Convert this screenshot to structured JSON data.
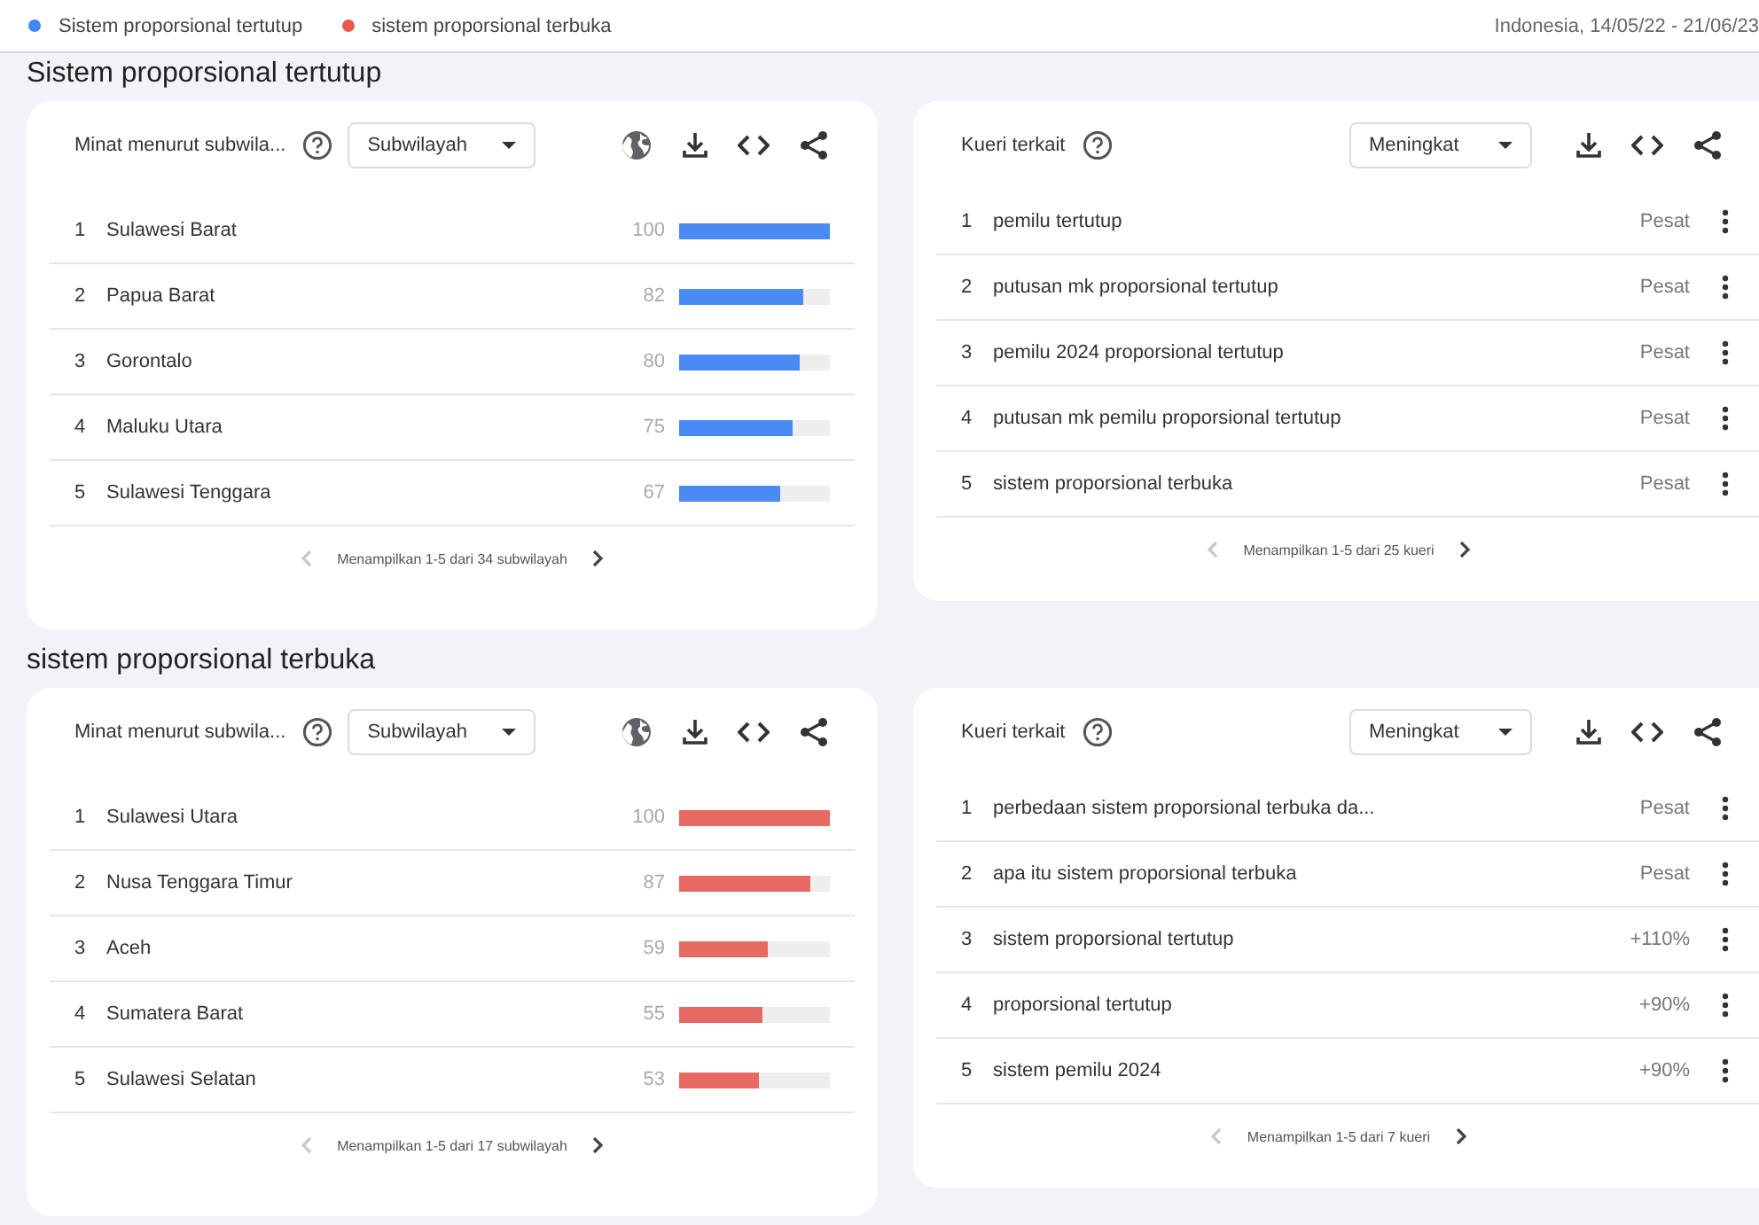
{
  "legend": [
    {
      "label": "Sistem proporsional tertutup",
      "color": "#4285f4"
    },
    {
      "label": "sistem proporsional terbuka",
      "color": "#e8574b"
    }
  ],
  "filter_summary": "Indonesia, 14/05/22 - 21/06/23",
  "sections": [
    {
      "title": "Sistem proporsional tertutup",
      "color": "#4a8af4",
      "cards": [
        {
          "kind": "regions",
          "title": "Minat menurut subwila...",
          "dropdown": "Subwilayah",
          "rows": [
            {
              "rank": "1",
              "name": "Sulawesi Barat",
              "value": "100",
              "level": 1
            },
            {
              "rank": "2",
              "name": "Papua Barat",
              "value": "82",
              "level": 0.82
            },
            {
              "rank": "3",
              "name": "Gorontalo",
              "value": "80",
              "level": 0.8
            },
            {
              "rank": "4",
              "name": "Maluku Utara",
              "value": "75",
              "level": 0.75
            },
            {
              "rank": "5",
              "name": "Sulawesi Tenggara",
              "value": "67",
              "level": 0.67
            }
          ],
          "footer": "Menampilkan 1-5 dari 34 subwilayah"
        },
        {
          "kind": "queries",
          "title": "Kueri terkait",
          "dropdown": "Meningkat",
          "rows": [
            {
              "rank": "1",
              "name": "pemilu tertutup",
              "value": "Pesat"
            },
            {
              "rank": "2",
              "name": "putusan mk proporsional tertutup",
              "value": "Pesat"
            },
            {
              "rank": "3",
              "name": "pemilu 2024 proporsional tertutup",
              "value": "Pesat"
            },
            {
              "rank": "4",
              "name": "putusan mk pemilu proporsional tertutup",
              "value": "Pesat"
            },
            {
              "rank": "5",
              "name": "sistem proporsional terbuka",
              "value": "Pesat"
            }
          ],
          "footer": "Menampilkan 1-5 dari 25 kueri"
        }
      ]
    },
    {
      "title": "sistem proporsional terbuka",
      "color": "#e66a62",
      "cards": [
        {
          "kind": "regions",
          "title": "Minat menurut subwila...",
          "dropdown": "Subwilayah",
          "rows": [
            {
              "rank": "1",
              "name": "Sulawesi Utara",
              "value": "100",
              "level": 1
            },
            {
              "rank": "2",
              "name": "Nusa Tenggara Timur",
              "value": "87",
              "level": 0.87
            },
            {
              "rank": "3",
              "name": "Aceh",
              "value": "59",
              "level": 0.59
            },
            {
              "rank": "4",
              "name": "Sumatera Barat",
              "value": "55",
              "level": 0.55
            },
            {
              "rank": "5",
              "name": "Sulawesi Selatan",
              "value": "53",
              "level": 0.53
            }
          ],
          "footer": "Menampilkan 1-5 dari 17 subwilayah"
        },
        {
          "kind": "queries",
          "title": "Kueri terkait",
          "dropdown": "Meningkat",
          "rows": [
            {
              "rank": "1",
              "name": "perbedaan sistem proporsional terbuka da...",
              "value": "Pesat"
            },
            {
              "rank": "2",
              "name": "apa itu sistem proporsional terbuka",
              "value": "Pesat"
            },
            {
              "rank": "3",
              "name": "sistem proporsional tertutup",
              "value": "+110%"
            },
            {
              "rank": "4",
              "name": "proporsional tertutup",
              "value": "+90%"
            },
            {
              "rank": "5",
              "name": "sistem pemilu 2024",
              "value": "+90%"
            }
          ],
          "footer": "Menampilkan 1-5 dari 7 kueri"
        }
      ]
    }
  ]
}
